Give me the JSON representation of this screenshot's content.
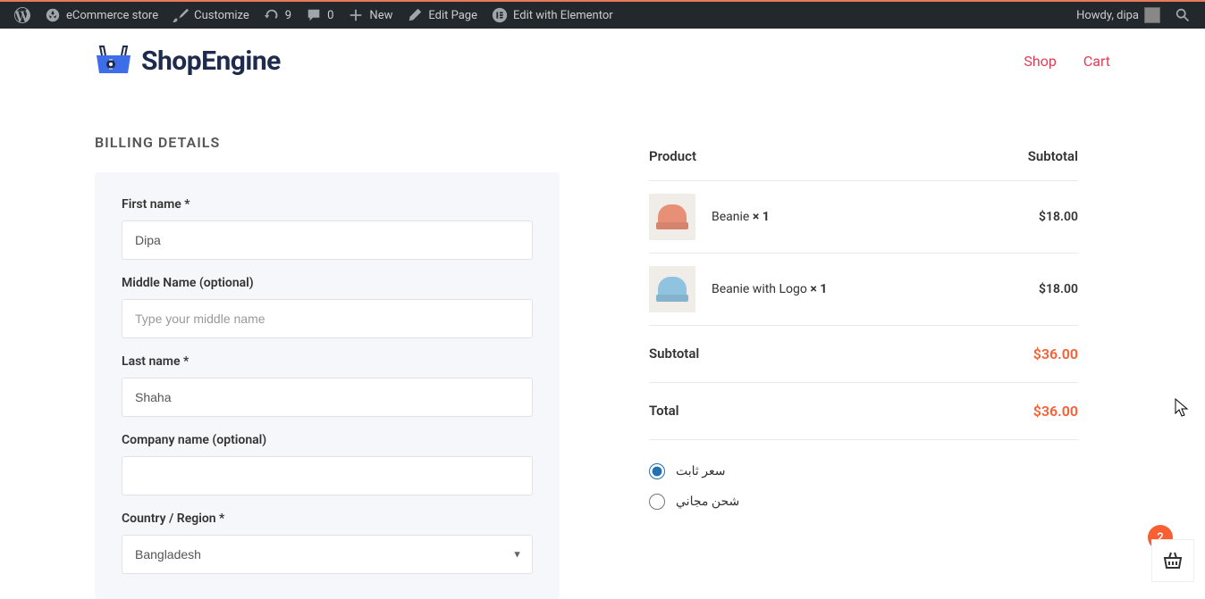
{
  "adminbar": {
    "site_name": "eCommerce store",
    "customize": "Customize",
    "updates_count": "9",
    "comments_count": "0",
    "new_label": "New",
    "edit_page": "Edit Page",
    "edit_elementor": "Edit with Elementor",
    "howdy": "Howdy, dipa"
  },
  "header": {
    "brand": "ShopEngine",
    "nav": {
      "shop": "Shop",
      "cart": "Cart"
    }
  },
  "billing": {
    "title": "BILLING DETAILS",
    "first_name_label": "First name *",
    "first_name_value": "Dipa",
    "middle_name_label": "Middle Name (optional)",
    "middle_name_placeholder": "Type your middle name",
    "last_name_label": "Last name *",
    "last_name_value": "Shaha",
    "company_label": "Company name (optional)",
    "country_label": "Country / Region *",
    "country_value": "Bangladesh"
  },
  "summary": {
    "product_header": "Product",
    "subtotal_header": "Subtotal",
    "items": [
      {
        "name": "Beanie",
        "qty": "× 1",
        "price": "$18.00",
        "color": "orange"
      },
      {
        "name": "Beanie with Logo",
        "qty": "× 1",
        "price": "$18.00",
        "color": "blue"
      }
    ],
    "subtotal_label": "Subtotal",
    "subtotal_amount": "$36.00",
    "total_label": "Total",
    "total_amount": "$36.00"
  },
  "shipping": {
    "flat": "سعر ثابت",
    "free": "شحن مجاني"
  },
  "cart": {
    "badge": "2"
  }
}
